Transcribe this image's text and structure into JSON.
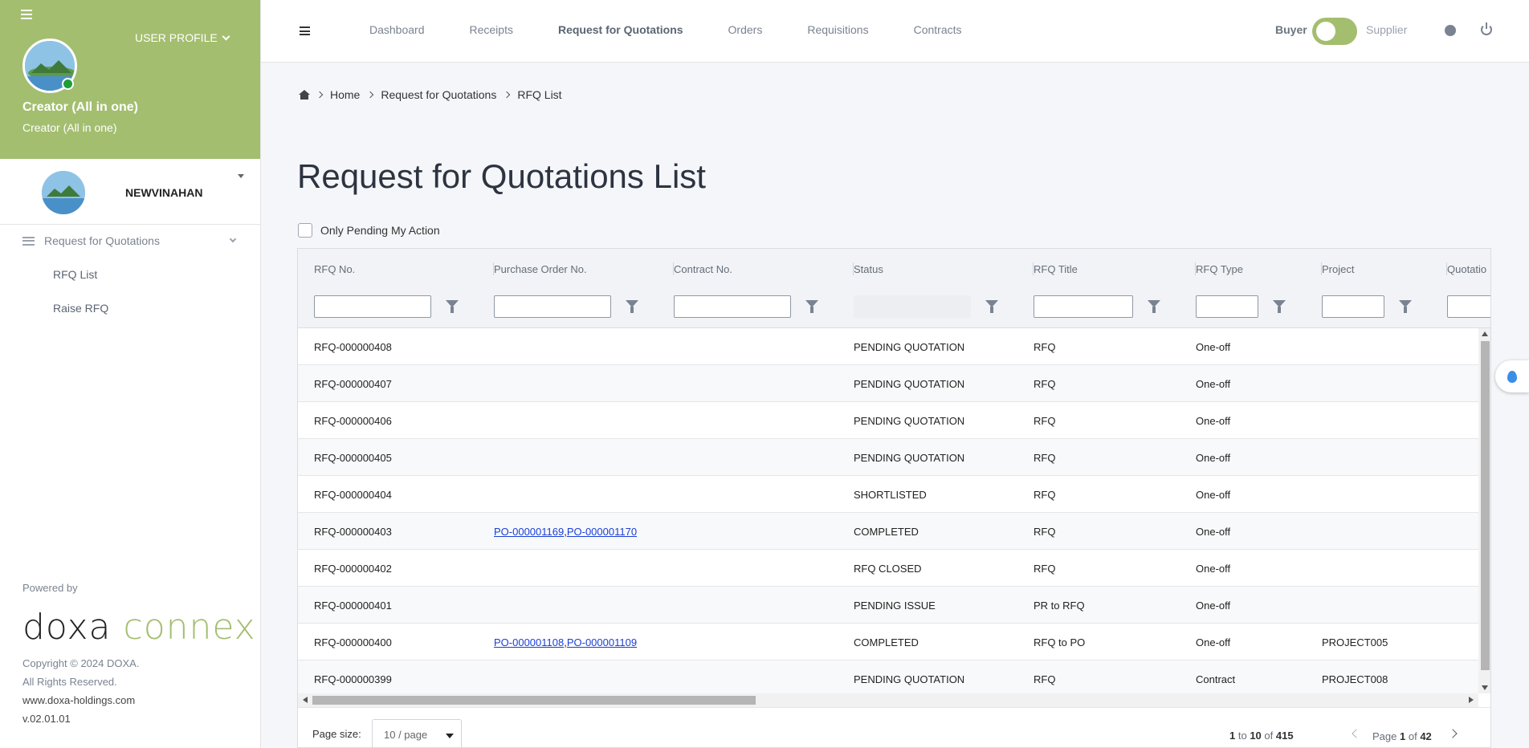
{
  "sidebar": {
    "user_profile_label": "USER PROFILE",
    "profile_name": "Creator (All in one)",
    "profile_role": "Creator (All in one)",
    "company_name": "NEWVINAHAN",
    "nav_group_label": "Request for Quotations",
    "nav_items": [
      "RFQ List",
      "Raise RFQ"
    ],
    "powered_by": "Powered by",
    "brand_part1": "doxa",
    "brand_part2": "connex",
    "copyright": "Copyright © 2024 DOXA.",
    "rights": "All Rights Reserved.",
    "website": "www.doxa-holdings.com",
    "version": "v.02.01.01"
  },
  "topbar": {
    "nav": [
      "Dashboard",
      "Receipts",
      "Request for Quotations",
      "Orders",
      "Requisitions",
      "Contracts"
    ],
    "active_nav": "Request for Quotations",
    "buyer_label": "Buyer",
    "supplier_label": "Supplier"
  },
  "breadcrumb": [
    "Home",
    "Request for Quotations",
    "RFQ List"
  ],
  "page_title": "Request for Quotations List",
  "pending_filter_label": "Only Pending My Action",
  "table": {
    "columns": [
      "RFQ No.",
      "Purchase Order No.",
      "Contract No.",
      "Status",
      "RFQ Title",
      "RFQ Type",
      "Project",
      "Quotatio"
    ],
    "rows": [
      {
        "rfq": "RFQ-000000408",
        "po": [],
        "contract": "",
        "status": "PENDING QUOTATION",
        "title": "RFQ",
        "type": "One-off",
        "project": ""
      },
      {
        "rfq": "RFQ-000000407",
        "po": [],
        "contract": "",
        "status": "PENDING QUOTATION",
        "title": "RFQ",
        "type": "One-off",
        "project": ""
      },
      {
        "rfq": "RFQ-000000406",
        "po": [],
        "contract": "",
        "status": "PENDING QUOTATION",
        "title": "RFQ",
        "type": "One-off",
        "project": ""
      },
      {
        "rfq": "RFQ-000000405",
        "po": [],
        "contract": "",
        "status": "PENDING QUOTATION",
        "title": "RFQ",
        "type": "One-off",
        "project": ""
      },
      {
        "rfq": "RFQ-000000404",
        "po": [],
        "contract": "",
        "status": "SHORTLISTED",
        "title": "RFQ",
        "type": "One-off",
        "project": ""
      },
      {
        "rfq": "RFQ-000000403",
        "po": [
          "PO-000001169",
          "PO-000001170"
        ],
        "contract": "",
        "status": "COMPLETED",
        "title": "RFQ",
        "type": "One-off",
        "project": ""
      },
      {
        "rfq": "RFQ-000000402",
        "po": [],
        "contract": "",
        "status": "RFQ CLOSED",
        "title": "RFQ",
        "type": "One-off",
        "project": ""
      },
      {
        "rfq": "RFQ-000000401",
        "po": [],
        "contract": "",
        "status": "PENDING ISSUE",
        "title": "PR to RFQ",
        "type": "One-off",
        "project": ""
      },
      {
        "rfq": "RFQ-000000400",
        "po": [
          "PO-000001108",
          "PO-000001109"
        ],
        "contract": "",
        "status": "COMPLETED",
        "title": "RFQ to PO",
        "type": "One-off",
        "project": "PROJECT005"
      },
      {
        "rfq": "RFQ-000000399",
        "po": [],
        "contract": "",
        "status": "PENDING QUOTATION",
        "title": "RFQ",
        "type": "Contract",
        "project": "PROJECT008"
      }
    ]
  },
  "pager": {
    "page_size_label": "Page size:",
    "page_size_value": "10 / page",
    "range_from": "1",
    "range_to_word": "to",
    "range_to": "10",
    "of_word": "of",
    "total": "415",
    "page_word": "Page",
    "current_page": "1",
    "total_pages": "42"
  },
  "colors": {
    "brand_green": "#a3be6f",
    "link_blue": "#1a3fd6"
  }
}
